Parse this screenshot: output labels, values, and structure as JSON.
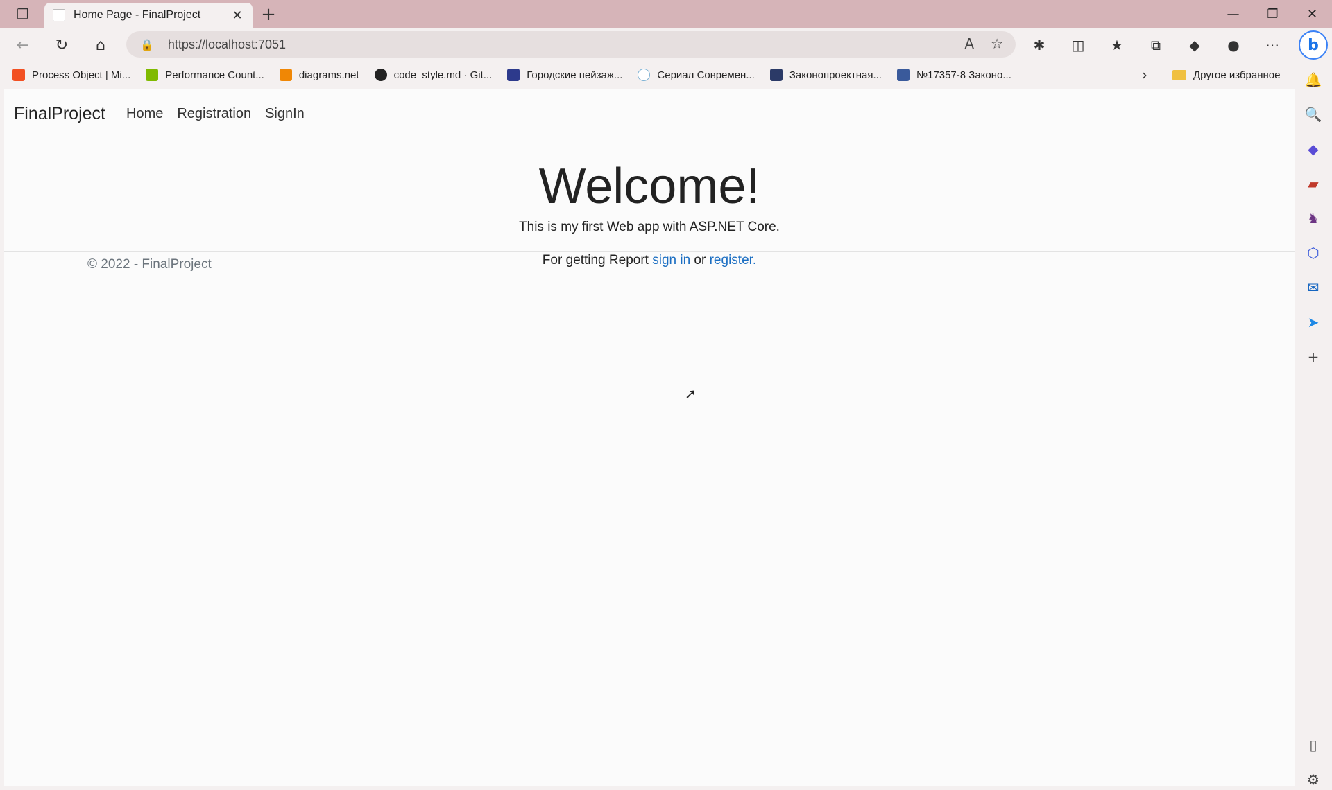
{
  "tab": {
    "title": "Home Page - FinalProject"
  },
  "address": {
    "url": "https://localhost:7051"
  },
  "bookmarks": [
    {
      "label": "Process Object | Mi...",
      "color": "#f25022"
    },
    {
      "label": "Performance Count...",
      "color": "#7fba00"
    },
    {
      "label": "diagrams.net",
      "color": "#f08705"
    },
    {
      "label": "code_style.md · Git...",
      "color": "#222222"
    },
    {
      "label": "Городские пейзаж...",
      "color": "#2d3a8c"
    },
    {
      "label": "Сериал Современ...",
      "color": "#7fb3d5"
    },
    {
      "label": "Законопроектная...",
      "color": "#2b3a67"
    },
    {
      "label": "№17357-8 Законо...",
      "color": "#3a5a9b"
    }
  ],
  "other_bookmarks": "Другое избранное",
  "navbar": {
    "brand": "FinalProject",
    "links": [
      "Home",
      "Registration",
      "SignIn"
    ]
  },
  "main": {
    "heading": "Welcome!",
    "subtitle": "This is my first Web app with ASP.NET Core.",
    "report_prefix": "For getting Report",
    "signin_link": "sign in",
    "or": "or",
    "register_link": "register."
  },
  "footer": {
    "text": "© 2022 - FinalProject"
  }
}
